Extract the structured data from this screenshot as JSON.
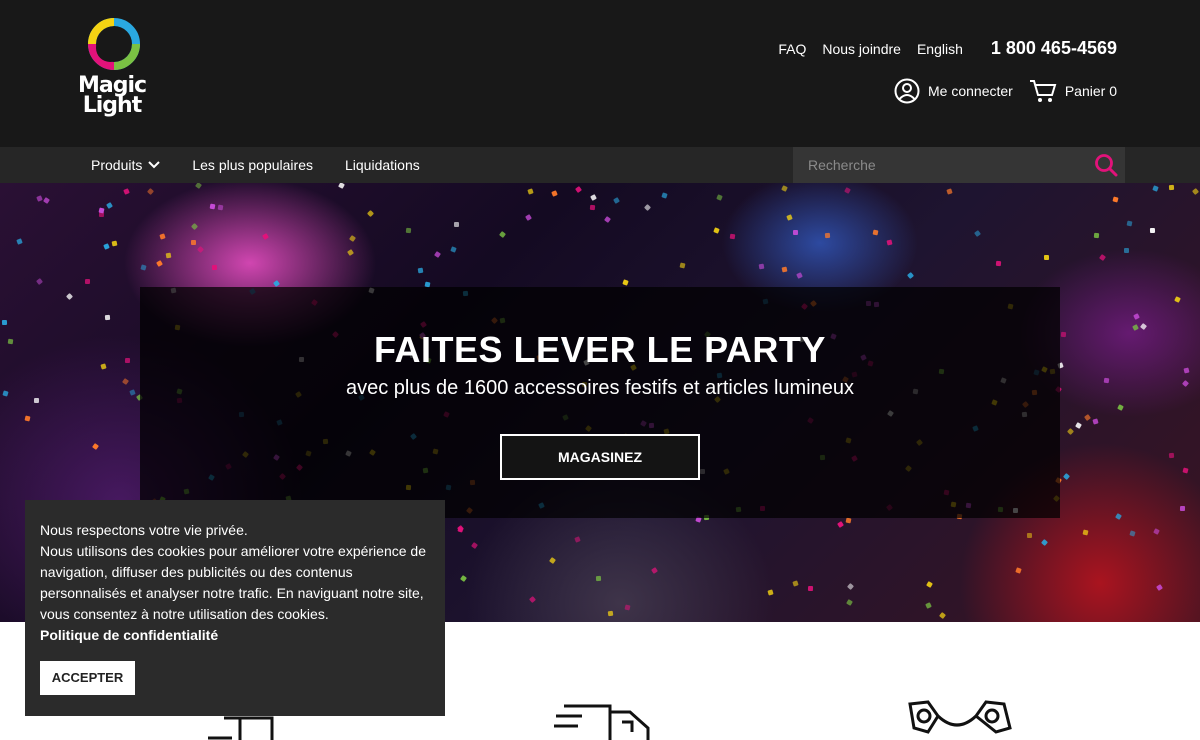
{
  "brand": {
    "name_line1": "Magic",
    "name_line2": "Light"
  },
  "toplinks": {
    "faq": "FAQ",
    "contact": "Nous joindre",
    "language": "English",
    "phone": "1 800 465-4569"
  },
  "account": {
    "login": "Me connecter",
    "cart": "Panier 0"
  },
  "nav": {
    "items": [
      {
        "label": "Produits"
      },
      {
        "label": "Les plus populaires"
      },
      {
        "label": "Liquidations"
      }
    ]
  },
  "search": {
    "placeholder": "Recherche"
  },
  "hero": {
    "title": "FAITES LEVER LE PARTY",
    "subtitle": "avec plus de 1600 accessoires festifs et articles lumineux",
    "button": "MAGASINEZ"
  },
  "cookie": {
    "line1": "Nous respectons votre vie privée.",
    "line2": "Nous utilisons des cookies pour améliorer votre expérience de navigation, diffuser des publicités ou des contenus personnalisés et analyser notre trafic. En naviguant notre site, vous consentez à notre utilisation des cookies.",
    "policy": "Politique de confidentialité",
    "accept": "ACCEPTER"
  },
  "colors": {
    "accent": "#e2127a",
    "header_bg": "#181818",
    "nav_bg": "#262626"
  },
  "icons": [
    "user-circle-icon",
    "cart-icon",
    "chevron-down-icon",
    "search-icon",
    "gift-icon",
    "truck-icon",
    "glasses-icon"
  ]
}
